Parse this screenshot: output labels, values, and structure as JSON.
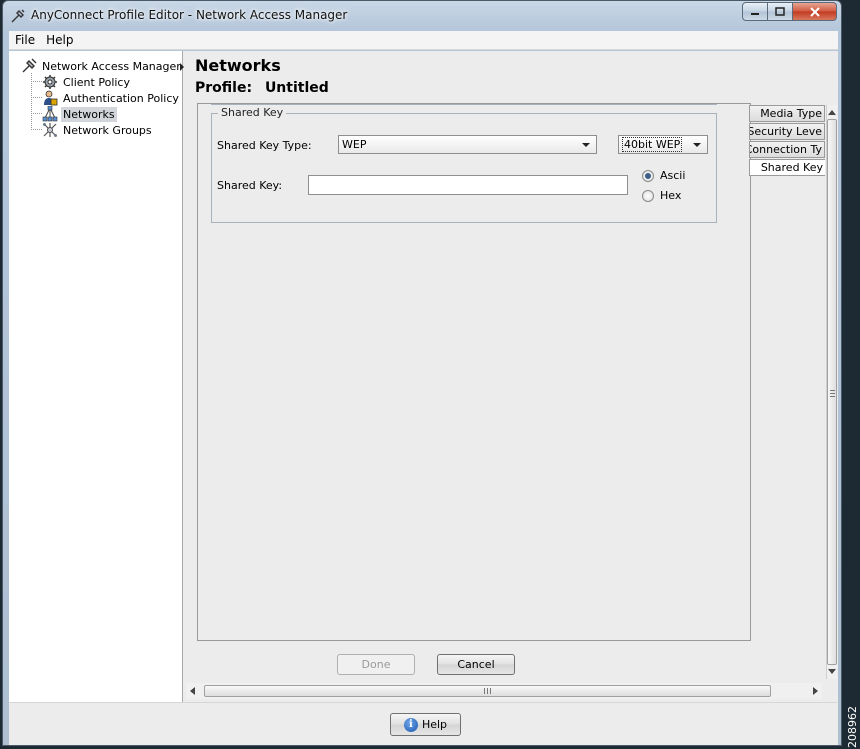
{
  "window": {
    "title": "AnyConnect Profile Editor - Network Access Manager"
  },
  "menu": {
    "items": [
      "File",
      "Help"
    ]
  },
  "tree": {
    "root": "Network Access Manager",
    "items": [
      "Client Policy",
      "Authentication Policy",
      "Networks",
      "Network Groups"
    ],
    "selected": "Networks"
  },
  "header": {
    "title": "Networks",
    "profile_label": "Profile:",
    "profile_name": "Untitled"
  },
  "shared_key": {
    "group_title": "Shared Key",
    "type_label": "Shared Key Type:",
    "type_value": "WEP",
    "wep_length": "40bit WEP",
    "key_label": "Shared Key:",
    "key_value": "",
    "format_options": [
      "Ascii",
      "Hex"
    ],
    "format_selected": "Ascii"
  },
  "tabs": {
    "items": [
      "Media Type",
      "Security Leve",
      "Connection Ty",
      "Shared Key"
    ],
    "active": "Shared Key"
  },
  "buttons": {
    "done": "Done",
    "cancel": "Cancel",
    "help": "Help"
  },
  "side_text": "208962"
}
